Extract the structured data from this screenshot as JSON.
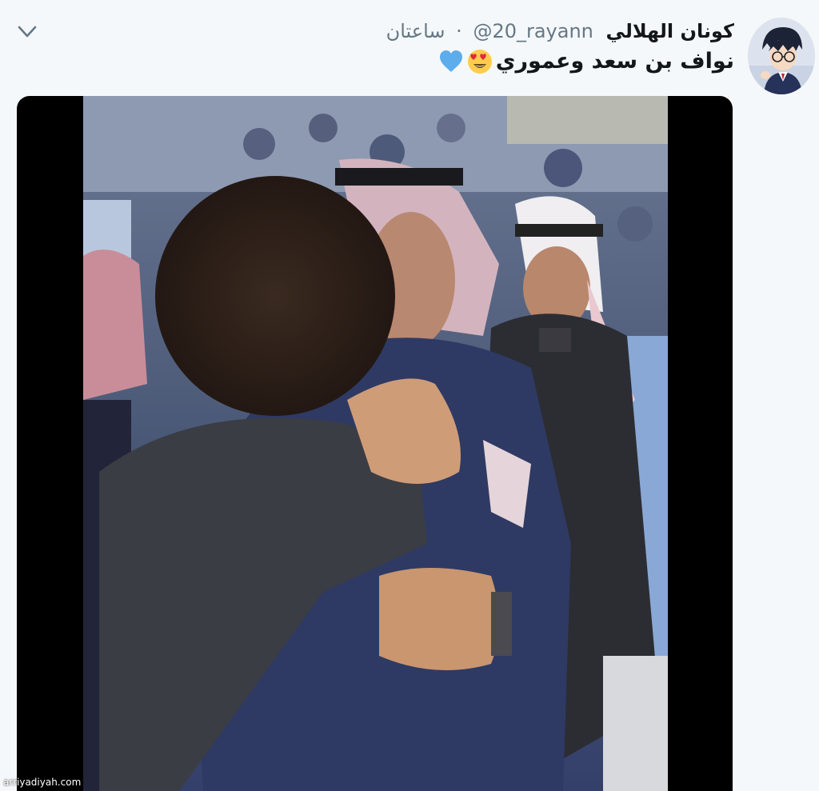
{
  "tweet": {
    "display_name": "كونان الهلالي",
    "handle": "@20_rayann",
    "separator": "·",
    "time": "ساعتان",
    "text": "نواف بن سعد وعموري"
  },
  "icons": {
    "menu": "chevron-down-icon",
    "emoji1": "smiling-face-with-heart-eyes-icon",
    "emoji2": "blue-heart-icon"
  },
  "colors": {
    "background": "#f5f8fa",
    "name": "#14171a",
    "secondary": "#657786",
    "blue_heart": "#5dadec"
  },
  "watermark": "arriyadiyah.com"
}
